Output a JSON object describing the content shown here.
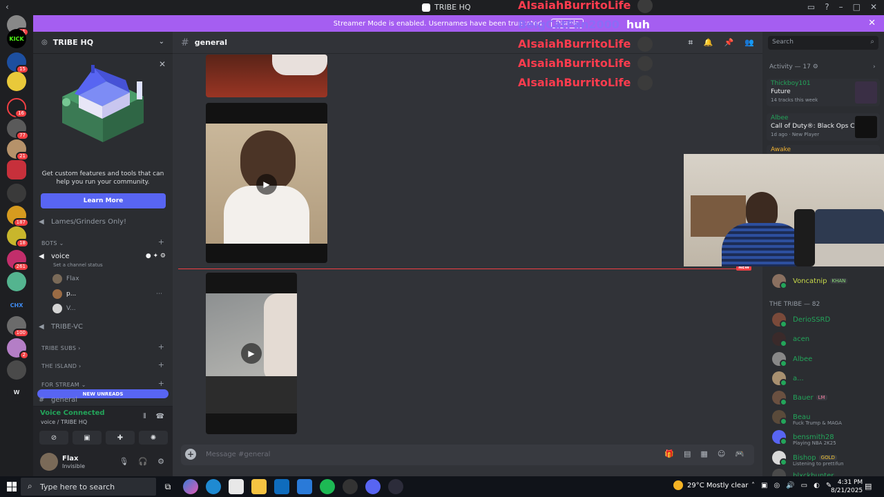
{
  "window": {
    "title": "TRIBE HQ"
  },
  "banner": {
    "text": "Streamer Mode is enabled. Usernames have been truncated.",
    "disable_label": "Disable",
    "color": "#a55ef1"
  },
  "server_rail": {
    "badges": [
      "11",
      "15",
      "16",
      "77",
      "21",
      "187",
      "18",
      "261",
      "100",
      "2"
    ],
    "labels": [
      "KICK",
      "CHX",
      "W"
    ]
  },
  "sidebar": {
    "server_name": "TRIBE HQ",
    "promo": {
      "text": "Get custom features and tools that can help you run your community.",
      "button": "Learn More"
    },
    "channels": {
      "lames": "Lames/Grinders Only!",
      "bots_category": "BOTS",
      "voice": "voice",
      "voice_status": "Set a channel status",
      "voice_users": [
        "Flax",
        "p...",
        "V..."
      ],
      "tribe_vc": "TRIBE-VC",
      "tribe_subs": "TRIBE SUBS",
      "the_island": "THE ISLAND",
      "for_stream": "FOR STREAM",
      "general": "general"
    },
    "new_unreads": "NEW UNREADS"
  },
  "voice_panel": {
    "status": "Voice Connected",
    "location": "voice / TRIBE HQ"
  },
  "user_panel": {
    "name": "Flax",
    "status": "Invisible"
  },
  "chat": {
    "channel": "general",
    "placeholder": "Message #general",
    "new_tag": "NEW"
  },
  "overlay_chat": [
    {
      "user": "AIsaiahBurritoLife",
      "msg": ""
    },
    {
      "user": "BeigCatFan2000",
      "msg": "huh"
    },
    {
      "user": "AIsaiahBurritoLife",
      "msg": ""
    },
    {
      "user": "AIsaiahBurritoLife",
      "msg": ""
    },
    {
      "user": "AIsaiahBurritoLife",
      "msg": ""
    }
  ],
  "member_list": {
    "search_placeholder": "Search",
    "activity_title": "Activity — 17",
    "activities": [
      {
        "user": "Thickboy101",
        "title": "Future",
        "sub": "14 tracks this week"
      },
      {
        "user": "Albee",
        "title": "Call of Duty®: Black Ops C...",
        "sub": "1d ago · New Player"
      },
      {
        "user": "Awake",
        "title": "",
        "sub": ""
      }
    ],
    "top_member": {
      "name": "Voncatnip",
      "tag": "KHAN"
    },
    "tribe_title": "THE TRIBE — 82",
    "members": [
      {
        "name": "ꓓerioSSRꓓ",
        "tag": "",
        "sub": ""
      },
      {
        "name": "acen",
        "tag": "",
        "sub": ""
      },
      {
        "name": "Albee",
        "tag": "",
        "sub": ""
      },
      {
        "name": "a...",
        "tag": "",
        "sub": ""
      },
      {
        "name": "Bauer",
        "tag": "LM",
        "sub": ""
      },
      {
        "name": "Beau",
        "tag": "",
        "sub": "Fuck Trump & MAGA"
      },
      {
        "name": "bensmith28",
        "tag": "",
        "sub": "Playing NBA 2K25"
      },
      {
        "name": "Bishop",
        "tag": "GOLD",
        "sub": "Listening to prettifun"
      },
      {
        "name": "blxckhunter",
        "tag": "",
        "sub": ""
      }
    ]
  },
  "taskbar": {
    "search_placeholder": "Type here to search",
    "weather": "29°C  Mostly clear",
    "time": "4:31 PM",
    "date": "8/21/2025"
  }
}
